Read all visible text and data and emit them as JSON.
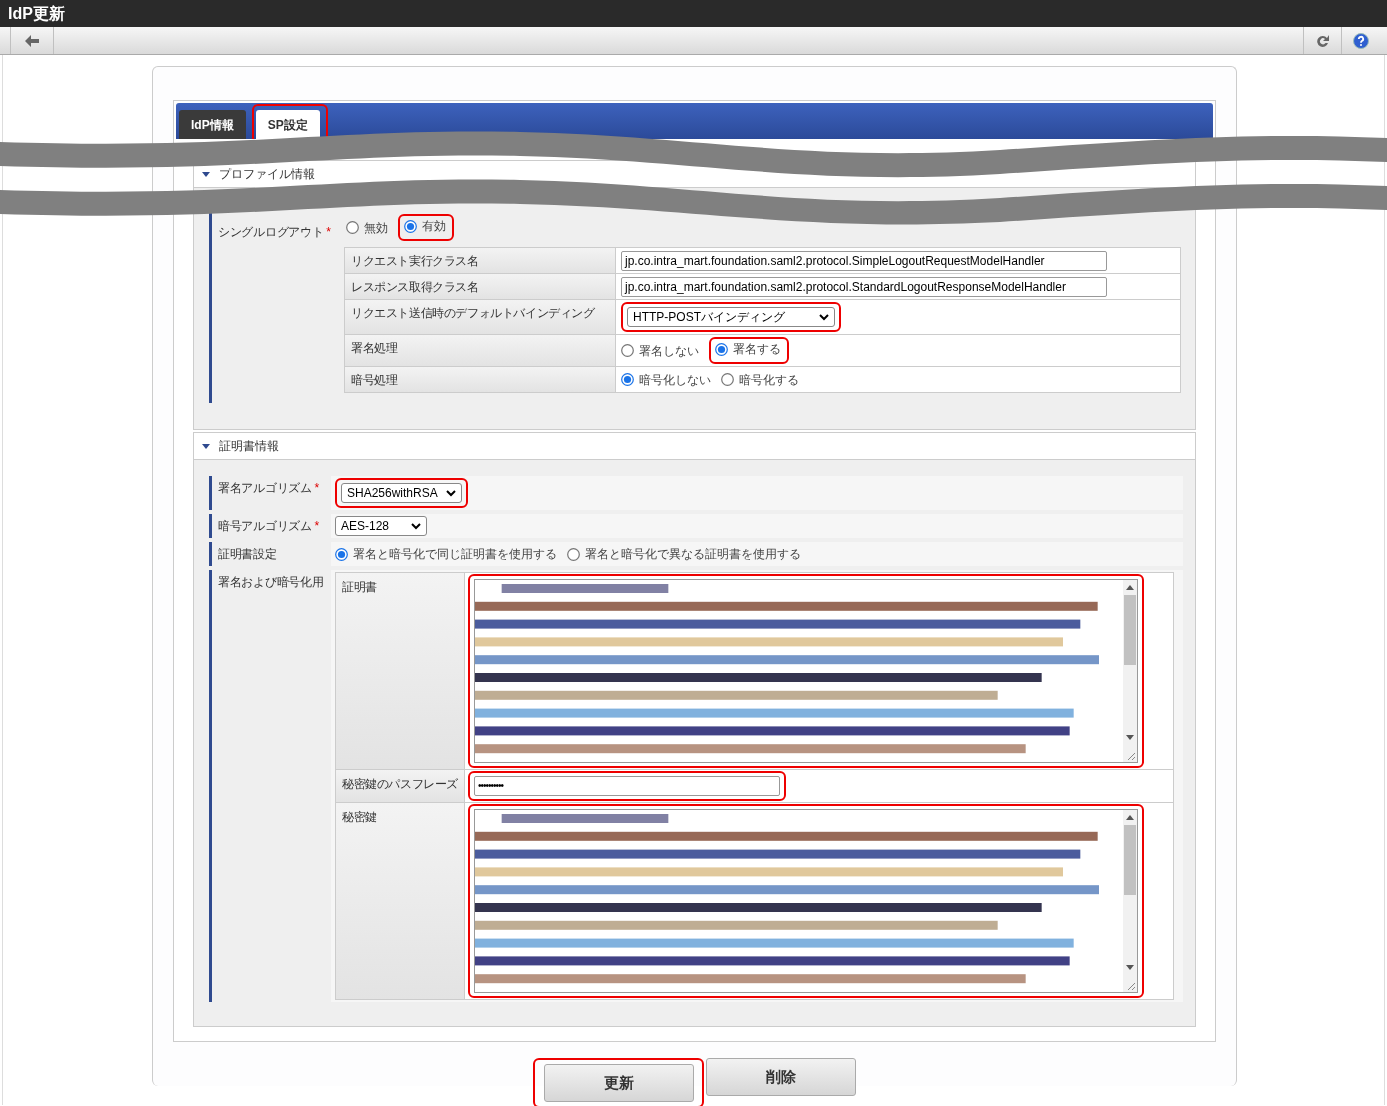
{
  "window": {
    "title": "IdP更新"
  },
  "tabs": [
    {
      "label": "IdP情報",
      "selected": false,
      "highlighted": false
    },
    {
      "label": "SP設定",
      "selected": true,
      "highlighted": true
    }
  ],
  "sections": [
    {
      "title": "プロファイル情報",
      "expanded": true,
      "rows": [
        {
          "label": "シングルログアウト",
          "required_mark": "*",
          "fields": [
            {
              "kind": "radio",
              "options": [
                {
                  "label": "無効",
                  "selected": false,
                  "highlighted": false
                },
                {
                  "label": "有効",
                  "selected": true,
                  "highlighted": true
                }
              ]
            },
            {
              "kind": "table",
              "rows": [
                {
                  "label": "リクエスト実行クラス名",
                  "fields": [
                    {
                      "kind": "text",
                      "value": "jp.co.intra_mart.foundation.saml2.protocol.SimpleLogoutRequestModelHandler",
                      "highlighted": false
                    }
                  ]
                },
                {
                  "label": "レスポンス取得クラス名",
                  "fields": [
                    {
                      "kind": "text",
                      "value": "jp.co.intra_mart.foundation.saml2.protocol.StandardLogoutResponseModelHandler",
                      "highlighted": false
                    }
                  ]
                },
                {
                  "label": "リクエスト送信時のデフォルトバインディング",
                  "fields": [
                    {
                      "kind": "select",
                      "value": "HTTP-POSTバインディング",
                      "highlighted": true
                    }
                  ]
                },
                {
                  "label": "署名処理",
                  "fields": [
                    {
                      "kind": "radio",
                      "options": [
                        {
                          "label": "署名しない",
                          "selected": false,
                          "highlighted": false
                        },
                        {
                          "label": "署名する",
                          "selected": true,
                          "highlighted": true
                        }
                      ]
                    }
                  ]
                },
                {
                  "label": "暗号処理",
                  "fields": [
                    {
                      "kind": "radio",
                      "options": [
                        {
                          "label": "暗号化しない",
                          "selected": true,
                          "highlighted": false
                        },
                        {
                          "label": "暗号化する",
                          "selected": false,
                          "highlighted": false
                        }
                      ]
                    }
                  ]
                }
              ]
            }
          ]
        }
      ]
    },
    {
      "title": "証明書情報",
      "expanded": true,
      "rows": [
        {
          "label": "署名アルゴリズム",
          "required_mark": "*",
          "fields": [
            {
              "kind": "select",
              "value": "SHA256withRSA",
              "highlighted": true
            }
          ]
        },
        {
          "label": "暗号アルゴリズム",
          "required_mark": "*",
          "fields": [
            {
              "kind": "select",
              "value": "AES-128",
              "highlighted": false
            }
          ]
        },
        {
          "label": "証明書設定",
          "fields": [
            {
              "kind": "radio",
              "options": [
                {
                  "label": "署名と暗号化で同じ証明書を使用する",
                  "selected": true,
                  "highlighted": false
                },
                {
                  "label": "署名と暗号化で異なる証明書を使用する",
                  "selected": false,
                  "highlighted": false
                }
              ]
            }
          ]
        },
        {
          "label": "署名および暗号化用",
          "fields": [
            {
              "kind": "table",
              "rows": [
                {
                  "label": "証明書",
                  "fields": [
                    {
                      "kind": "textarea",
                      "highlighted": true
                    }
                  ]
                },
                {
                  "label": "秘密鍵のパスフレーズ",
                  "fields": [
                    {
                      "kind": "password",
                      "value": "••••••••••",
                      "highlighted": true
                    }
                  ]
                },
                {
                  "label": "秘密鍵",
                  "fields": [
                    {
                      "kind": "textarea",
                      "highlighted": true
                    }
                  ]
                }
              ]
            }
          ]
        }
      ]
    }
  ],
  "buttons": [
    {
      "label": "更新",
      "highlighted": true
    },
    {
      "label": "削除",
      "highlighted": false
    }
  ]
}
